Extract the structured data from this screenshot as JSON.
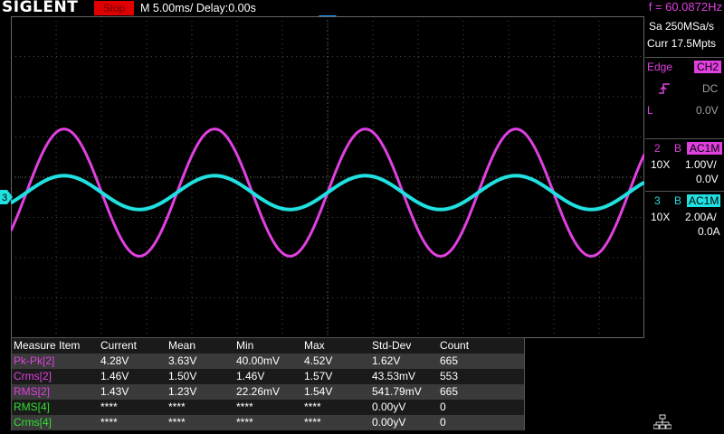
{
  "topbar": {
    "logo": "SIGLENT",
    "run_state": "Stop",
    "timebase": "M 5.00ms/ Delay:0.00s",
    "frequency": "f = 60.0872Hz"
  },
  "acquisition": {
    "sample_rate": "Sa 250MSa/s",
    "memory_depth": "Curr 17.5Mpts"
  },
  "trigger": {
    "type": "Edge",
    "source": "CH2",
    "slope_icon": "rising-edge-icon",
    "coupling": "DC",
    "level_label": "L",
    "level": "0.0V"
  },
  "channels": [
    {
      "num": "2",
      "b": "B",
      "coupling": "AC1M",
      "probe": "10X",
      "scale": "1.00V/",
      "offset": "0.0V",
      "color": "#e040e0"
    },
    {
      "num": "3",
      "b": "B",
      "coupling": "AC1M",
      "probe": "10X",
      "scale": "2.00A/",
      "offset": "0.0A",
      "color": "#20e0e0"
    }
  ],
  "ch3_marker": "3",
  "measure": {
    "headers": [
      "Measure Item",
      "Current",
      "Mean",
      "Min",
      "Max",
      "Std-Dev",
      "Count"
    ],
    "rows": [
      {
        "item": "Pk-Pk[2]",
        "current": "4.28V",
        "mean": "3.63V",
        "min": "40.00mV",
        "max": "4.52V",
        "std": "1.62V",
        "count": "665",
        "color": "#e040e0"
      },
      {
        "item": "Crms[2]",
        "current": "1.46V",
        "mean": "1.50V",
        "min": "1.46V",
        "max": "1.57V",
        "std": "43.53mV",
        "count": "553",
        "color": "#e040e0"
      },
      {
        "item": "RMS[2]",
        "current": "1.43V",
        "mean": "1.23V",
        "min": "22.26mV",
        "max": "1.54V",
        "std": "541.79mV",
        "count": "665",
        "color": "#e040e0"
      },
      {
        "item": "RMS[4]",
        "current": "****",
        "mean": "****",
        "min": "****",
        "max": "****",
        "std": "0.00yV",
        "count": "0",
        "color": "#30e030"
      },
      {
        "item": "Crms[4]",
        "current": "****",
        "mean": "****",
        "min": "****",
        "max": "****",
        "std": "0.00yV",
        "count": "0",
        "color": "#30e030"
      }
    ]
  },
  "waveforms": {
    "ch2": {
      "frequency_hz": 60.0872,
      "peak_divisions": 1.58,
      "color": "#e040e0"
    },
    "ch3": {
      "frequency_hz": 60.0872,
      "peak_divisions": 0.42,
      "color": "#20e0e0"
    }
  },
  "status_icons": [
    "network-icon"
  ]
}
